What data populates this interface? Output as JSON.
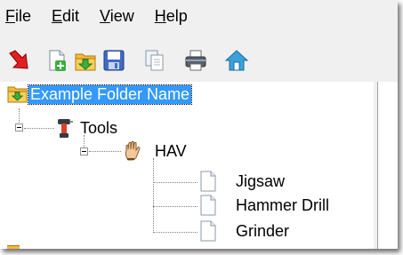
{
  "menu": [
    {
      "underline": "F",
      "rest": "ile"
    },
    {
      "underline": "E",
      "rest": "dit"
    },
    {
      "underline": "V",
      "rest": "iew"
    },
    {
      "underline": "H",
      "rest": "elp"
    }
  ],
  "toolbar": {
    "buttons": [
      {
        "icon": "red-arrow-icon"
      },
      {
        "icon": "new-document-icon"
      },
      {
        "icon": "open-folder-icon"
      },
      {
        "icon": "save-icon"
      },
      {
        "icon": "copy-icon"
      },
      {
        "icon": "print-icon"
      },
      {
        "icon": "home-icon"
      }
    ]
  },
  "tree": {
    "root": {
      "label": "Example Folder Name"
    },
    "tools": {
      "label": "Tools"
    },
    "hav": {
      "label": "HAV"
    },
    "children": [
      {
        "label": "Jigsaw"
      },
      {
        "label": "Hammer Drill"
      },
      {
        "label": "Grinder"
      }
    ]
  },
  "colors": {
    "selection": "#3399ff",
    "window_bg": "#f0f0f0"
  }
}
